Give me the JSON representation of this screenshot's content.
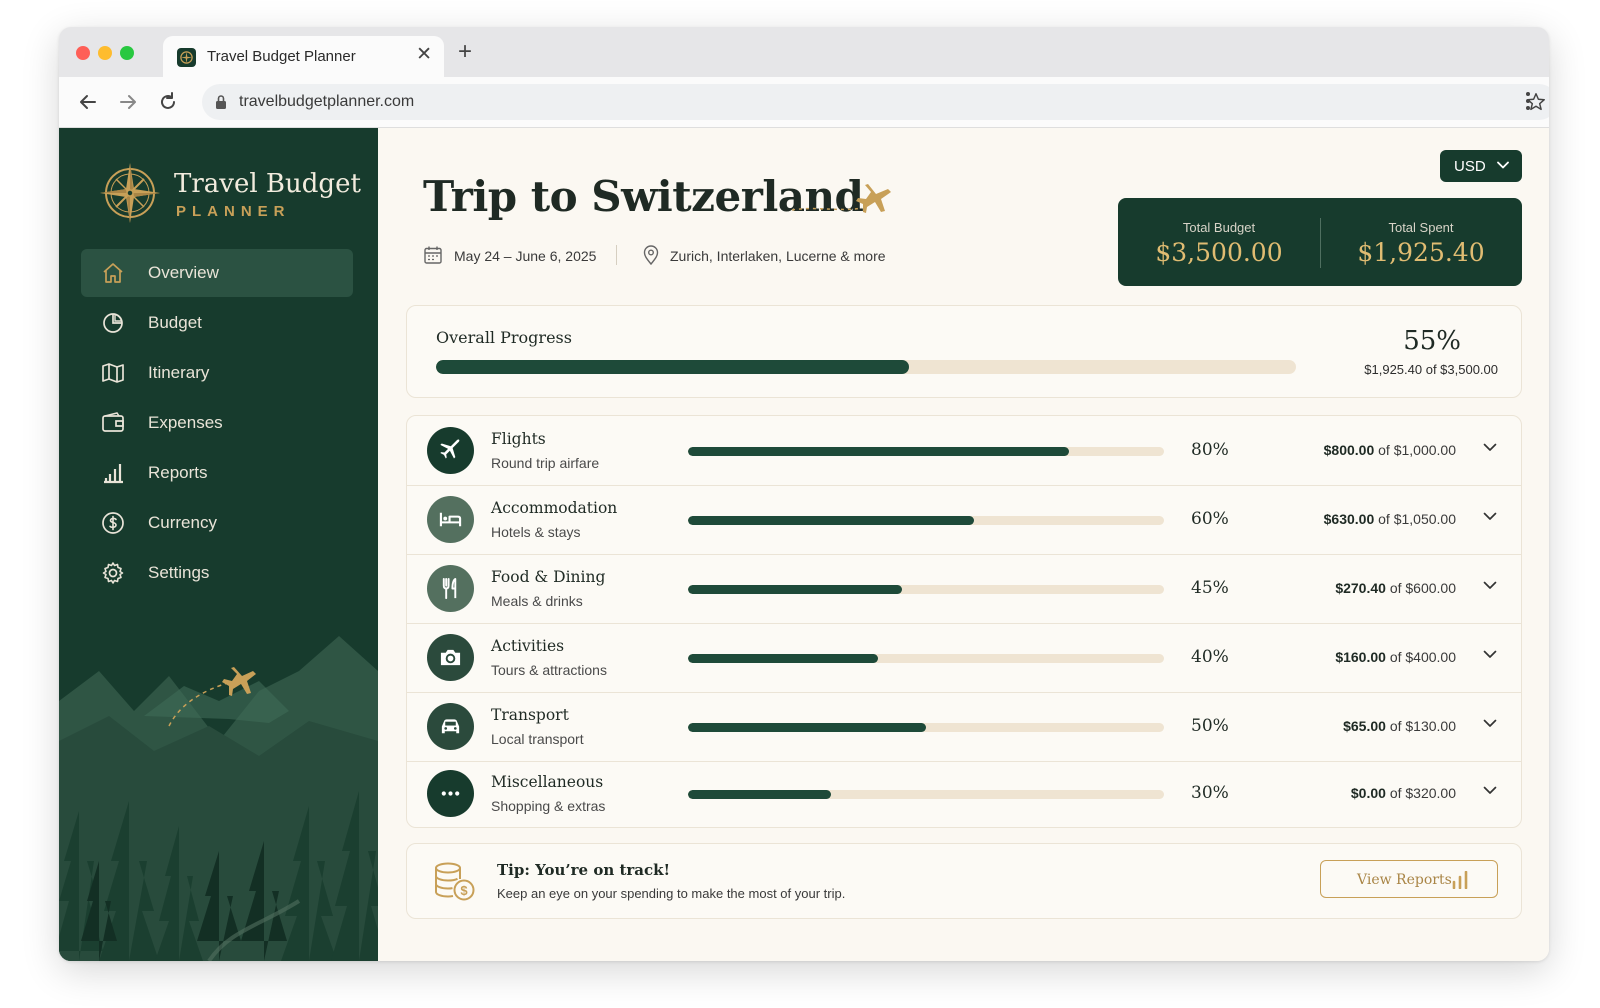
{
  "browser": {
    "tab_title": "Travel Budget Planner",
    "url": "travelbudgetplanner.com"
  },
  "sidebar": {
    "brand_title": "Travel Budget",
    "brand_subtitle": "PLANNER",
    "items": [
      {
        "label": "Overview",
        "icon": "home-icon",
        "active": true
      },
      {
        "label": "Budget",
        "icon": "pie-chart-icon",
        "active": false
      },
      {
        "label": "Itinerary",
        "icon": "map-icon",
        "active": false
      },
      {
        "label": "Expenses",
        "icon": "wallet-icon",
        "active": false
      },
      {
        "label": "Reports",
        "icon": "bar-chart-icon",
        "active": false
      },
      {
        "label": "Currency",
        "icon": "dollar-circle-icon",
        "active": false
      },
      {
        "label": "Settings",
        "icon": "gear-icon",
        "active": false
      }
    ]
  },
  "header": {
    "currency": "USD",
    "trip_title": "Trip to Switzerland",
    "dates": "May 24 – June 6, 2025",
    "locations": "Zurich, Interlaken, Lucerne & more"
  },
  "totals": {
    "budget_label": "Total Budget",
    "budget_value": "$3,500.00",
    "spent_label": "Total Spent",
    "spent_value": "$1,925.40"
  },
  "progress": {
    "label": "Overall Progress",
    "percent": 55,
    "percent_text": "55%",
    "detail": "$1,925.40 of $3,500.00"
  },
  "categories": [
    {
      "name": "Flights",
      "desc": "Round trip airfare",
      "percent": 80,
      "percent_text": "80%",
      "spent": "$800.00",
      "of": "of $1,000.00",
      "icon": "plane-icon",
      "icon_color": "#173b2d"
    },
    {
      "name": "Accommodation",
      "desc": "Hotels & stays",
      "percent": 60,
      "percent_text": "60%",
      "spent": "$630.00",
      "of": "of $1,050.00",
      "icon": "bed-icon",
      "icon_color": "#54705f"
    },
    {
      "name": "Food & Dining",
      "desc": "Meals & drinks",
      "percent": 45,
      "percent_text": "45%",
      "spent": "$270.40",
      "of": "of $600.00",
      "icon": "utensils-icon",
      "icon_color": "#54705f"
    },
    {
      "name": "Activities",
      "desc": "Tours & attractions",
      "percent": 40,
      "percent_text": "40%",
      "spent": "$160.00",
      "of": "of $400.00",
      "icon": "camera-icon",
      "icon_color": "#2b4a3c"
    },
    {
      "name": "Transport",
      "desc": "Local transport",
      "percent": 50,
      "percent_text": "50%",
      "spent": "$65.00",
      "of": "of $130.00",
      "icon": "car-icon",
      "icon_color": "#2b4a3c"
    },
    {
      "name": "Miscellaneous",
      "desc": "Shopping & extras",
      "percent": 30,
      "percent_text": "30%",
      "spent": "$0.00",
      "of": "of $320.00",
      "icon": "more-icon",
      "icon_color": "#173b2d"
    }
  ],
  "tip": {
    "title": "Tip: You’re on track!",
    "text": "Keep an eye on your spending to make the most of your trip.",
    "button": "View Reports"
  },
  "colors": {
    "primary": "#173b2d",
    "accent": "#c8a058",
    "track": "#efe4d2",
    "background": "#fbf8f2"
  }
}
